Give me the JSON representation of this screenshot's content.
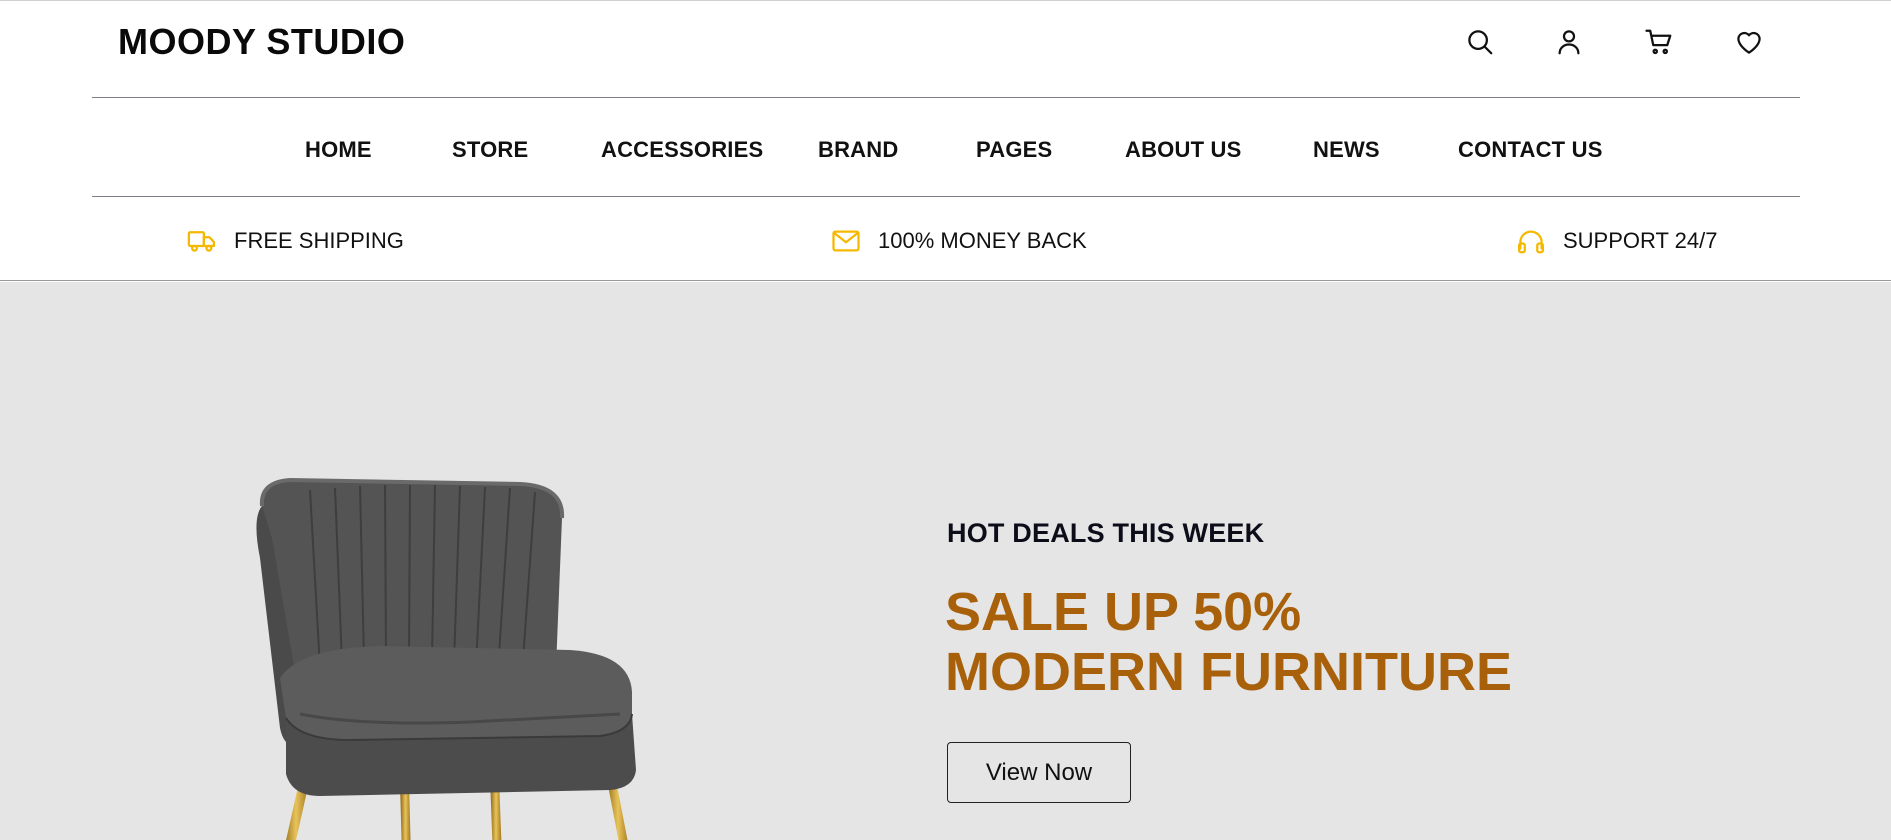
{
  "header": {
    "logo": "MOODY STUDIO",
    "icons": [
      "search-icon",
      "user-icon",
      "cart-icon",
      "heart-icon"
    ]
  },
  "nav": {
    "items": [
      "HOME",
      "STORE",
      "ACCESSORIES",
      "BRAND",
      "PAGES",
      "ABOUT US",
      "NEWS",
      "CONTACT US"
    ]
  },
  "features": [
    {
      "icon": "truck-icon",
      "label": "FREE SHIPPING"
    },
    {
      "icon": "mail-icon",
      "label": "100% MONEY BACK"
    },
    {
      "icon": "headphones-icon",
      "label": "SUPPORT 24/7"
    }
  ],
  "hero": {
    "subtitle": "HOT DEALS THIS WEEK",
    "title_line1": "SALE UP 50%",
    "title_line2": "MODERN FURNITURE",
    "button_label": "View Now"
  },
  "colors": {
    "accent": "#a8610a",
    "icon_accent": "#f5b800",
    "hero_background": "#e5e5e5"
  }
}
